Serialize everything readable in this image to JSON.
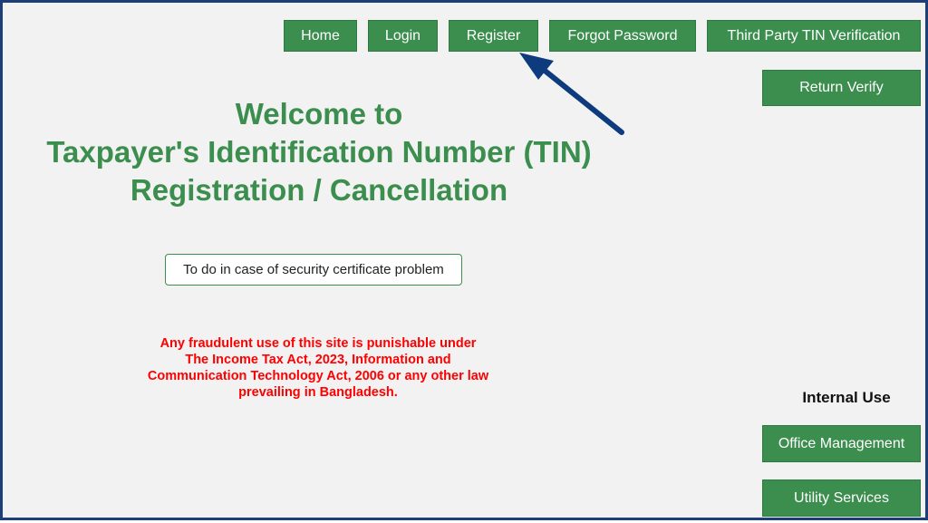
{
  "nav": {
    "home": "Home",
    "login": "Login",
    "register": "Register",
    "forgot_password": "Forgot Password",
    "third_party": "Third Party TIN Verification",
    "return_verify": "Return Verify"
  },
  "welcome": {
    "line1": "Welcome to",
    "line2": "Taxpayer's Identification Number (TIN)",
    "line3": "Registration / Cancellation"
  },
  "certificate_button": "To do in case of security certificate problem",
  "warning": {
    "line1": "Any fraudulent use of this site is punishable under",
    "line2": "The Income Tax Act, 2023, Information and",
    "line3": "Communication Technology Act, 2006 or any other law",
    "line4": "prevailing in Bangladesh."
  },
  "internal_use": {
    "heading": "Internal Use",
    "office_management": "Office Management",
    "utility_services": "Utility Services"
  },
  "colors": {
    "primary_green": "#3b8e4e",
    "warning_red": "#ff0000",
    "frame_blue": "#1c3f7a",
    "arrow_blue": "#0d3b7e"
  },
  "icons": {
    "annotation": "arrow-pointer-icon"
  }
}
